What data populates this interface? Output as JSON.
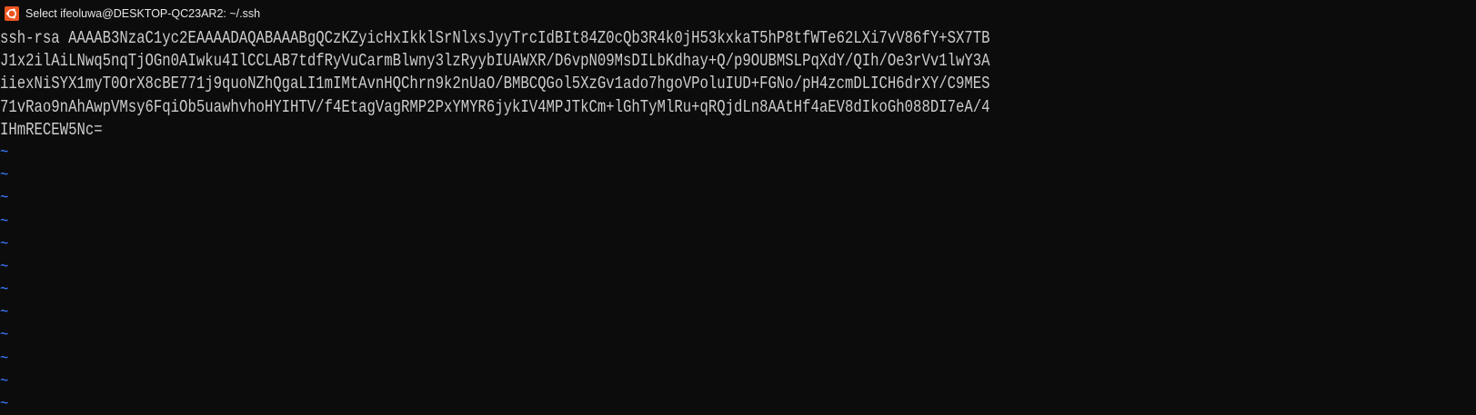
{
  "window": {
    "title": "Select ifeoluwa@DESKTOP-QC23AR2: ~/.ssh",
    "icon": "ubuntu-icon"
  },
  "colors": {
    "background": "#0c0c0c",
    "text": "#cccccc",
    "tilde": "#3b78ff",
    "icon": "#e95420"
  },
  "editor": {
    "lines": [
      "ssh-rsa AAAAB3NzaC1yc2EAAAADAQABAAABgQCzKZyicHxIkklSrNlxsJyyTrcIdBIt84Z0cQb3R4k0jH53kxkaT5hP8tfWTe62LXi7vV86fY+SX7TB",
      "J1x2ilAiLNwq5nqTjOGn0AIwku4IlCCLAB7tdfRyVuCarmBlwny3lzRyybIUAWXR/D6vpN09MsDILbKdhay+Q/p9OUBMSLPqXdY/QIh/Oe3rVv1lwY3A",
      "iiexNiSYX1myT0OrX8cBE771j9quoNZhQgaLI1mIMtAvnHQChrn9k2nUaO/BMBCQGol5XzGv1ado7hgoVPoluIUD+FGNo/pH4zcmDLICH6drXY/C9MES",
      "71vRao9nAhAwpVMsy6FqiOb5uawhvhoHYIHTV/f4EtagVagRMP2PxYMYR6jykIV4MPJTkCm+lGhTyMlRu+qRQjdLn8AAtHf4aEV8dIkoGh088DI7eA/4",
      "IHmRECEW5Nc="
    ],
    "empty_line_marker": "~"
  }
}
